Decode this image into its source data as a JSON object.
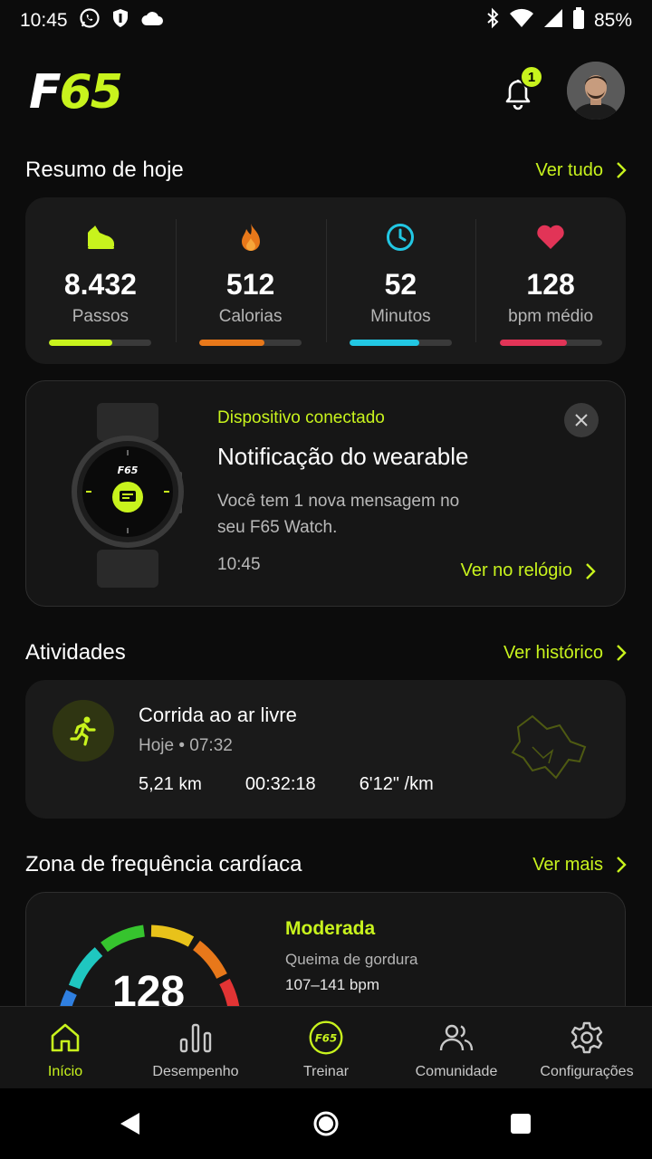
{
  "status_bar": {
    "time": "10:45",
    "battery": "85%",
    "icons": [
      "whatsapp-icon",
      "shield-icon",
      "cloud-icon",
      "bluetooth-icon",
      "wifi-icon",
      "signal-icon",
      "battery-icon"
    ]
  },
  "app": {
    "logo_letter": "F",
    "logo_number": "65",
    "notification_count": "1",
    "accent_color": "#c8f31d"
  },
  "summary": {
    "title": "Resumo de hoje",
    "link": "Ver tudo",
    "stats": [
      {
        "icon": "sneaker-icon",
        "value": "8.432",
        "label": "Passos",
        "progress": 0.62,
        "color": "#c8f31d"
      },
      {
        "icon": "flame-icon",
        "value": "512",
        "label": "Calorias",
        "progress": 0.64,
        "color": "#e8781a"
      },
      {
        "icon": "clock-icon",
        "value": "52",
        "label": "Minutos",
        "progress": 0.68,
        "color": "#22c7e3"
      },
      {
        "icon": "heart-icon",
        "value": "128",
        "label": "bpm médio",
        "progress": 0.66,
        "color": "#e23457"
      }
    ]
  },
  "notification": {
    "kicker": "Dispositivo conectado",
    "title": "Notificação do wearable",
    "body": "Você tem 1 nova mensagem no seu F65 Watch.",
    "time": "10:45",
    "cta": "Ver no relógio",
    "watch_brand": "F65"
  },
  "activities": {
    "title": "Atividades",
    "link": "Ver histórico",
    "item": {
      "title": "Corrida ao ar livre",
      "subtitle": "Hoje • 07:32",
      "distance": "5,21",
      "distance_unit": "km",
      "duration": "00:32:18",
      "pace": "6'12\" /km"
    }
  },
  "heart_zone": {
    "title": "Zona de frequência cardíaca",
    "link": "Ver mais",
    "value": "128",
    "zone": "Moderada",
    "description": "Queima de gordura",
    "range": "107–141 bpm"
  },
  "bottom_nav": [
    {
      "label": "Início",
      "icon": "home-icon",
      "active": true
    },
    {
      "label": "Desempenho",
      "icon": "bar-chart-icon",
      "active": false
    },
    {
      "label": "Treinar",
      "icon": "f65-train-icon",
      "active": false
    },
    {
      "label": "Comunidade",
      "icon": "community-icon",
      "active": false
    },
    {
      "label": "Configurações",
      "icon": "gear-icon",
      "active": false
    }
  ],
  "train_badge": "F65"
}
